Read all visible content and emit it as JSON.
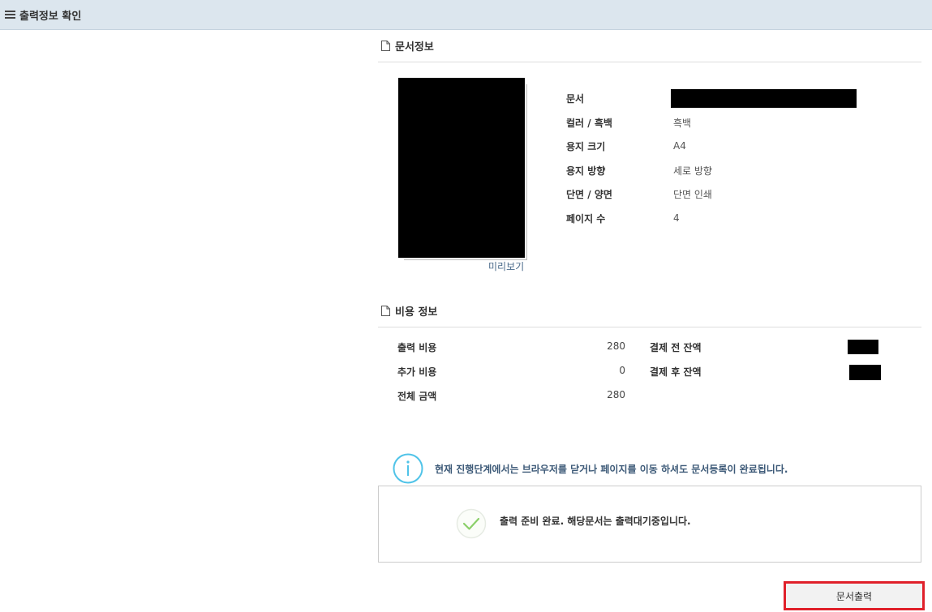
{
  "header": {
    "title": "출력정보 확인"
  },
  "document_section": {
    "title": "문서정보",
    "preview_link": "미리보기",
    "rows": [
      {
        "label": "문서",
        "value": ""
      },
      {
        "label": "컬러 / 흑백",
        "value": "흑백"
      },
      {
        "label": "용지 크기",
        "value": "A4"
      },
      {
        "label": "용지 방향",
        "value": "세로 방향"
      },
      {
        "label": "단면 / 양면",
        "value": "단면 인쇄"
      },
      {
        "label": "페이지 수",
        "value": "4"
      }
    ]
  },
  "cost_section": {
    "title": "비용 정보",
    "print_cost_label": "출력 비용",
    "print_cost_value": "280",
    "extra_cost_label": "추가 비용",
    "extra_cost_value": "0",
    "total_label": "전체 금액",
    "total_value": "280",
    "balance_before_label": "결제 전 잔액",
    "balance_after_label": "결제 후 잔액"
  },
  "notice": {
    "text": "현재 진행단계에서는 브라우저를 닫거나 페이지를 이동 하셔도 문서등록이 완료됩니다."
  },
  "status": {
    "text": "출력 준비 완료. 해당문서는 출력대기중입니다."
  },
  "actions": {
    "print_button": "문서출력"
  },
  "colors": {
    "header_bg": "#dce6ee",
    "notice_text": "#3d5a78",
    "info_icon": "#4fc3e8",
    "check_icon": "#8bd06a",
    "highlight_border": "#e0202a"
  }
}
